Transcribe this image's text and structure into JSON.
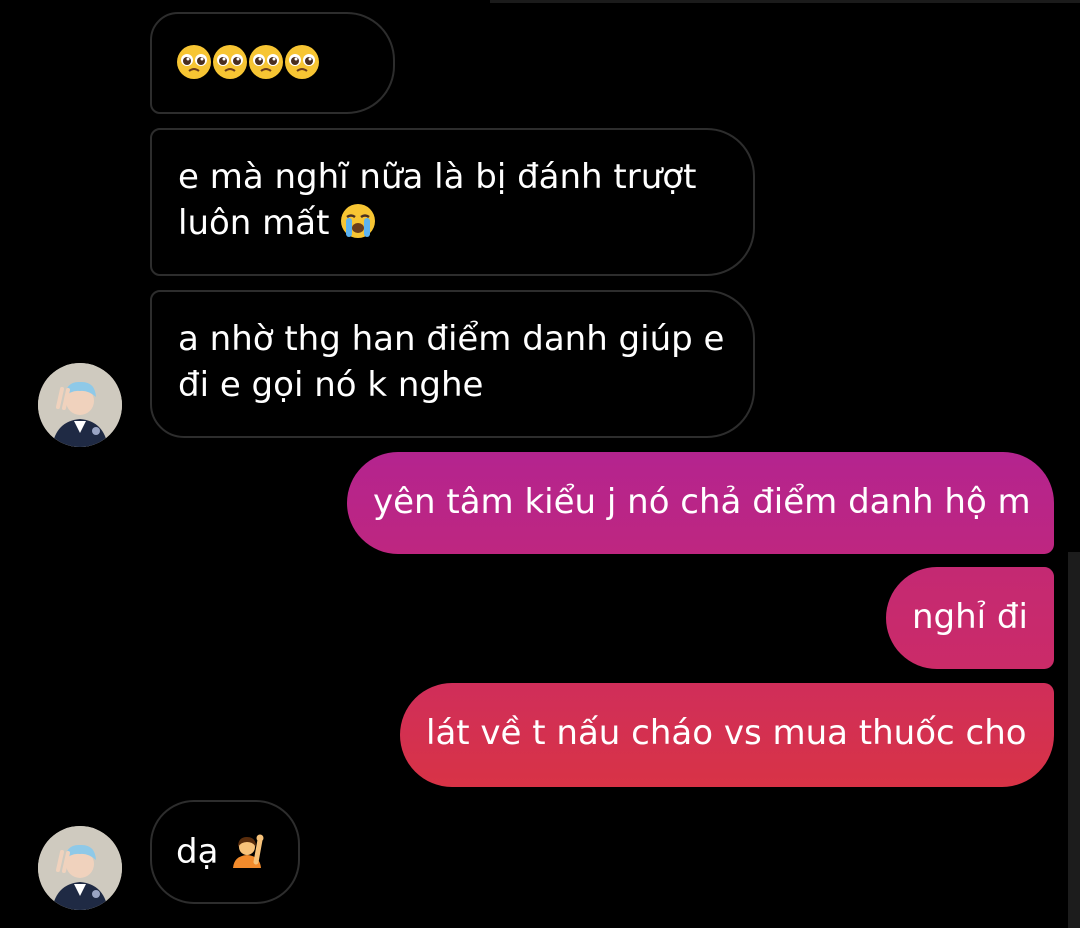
{
  "chat": {
    "messages": [
      {
        "id": "m1",
        "direction": "incoming",
        "text": "",
        "emojis": [
          "pleading-face-icon",
          "pleading-face-icon",
          "pleading-face-icon",
          "pleading-face-icon"
        ]
      },
      {
        "id": "m2",
        "direction": "incoming",
        "text_line1": "e mà nghĩ nữa là bị đánh trượt",
        "text_line2": "luôn mất",
        "emojis": [
          "loudly-crying-face-icon"
        ]
      },
      {
        "id": "m3",
        "direction": "incoming",
        "text_line1": "a nhờ thg han điểm danh giúp e",
        "text_line2": "đi e gọi nó k nghe",
        "emojis": []
      },
      {
        "id": "m4",
        "direction": "outgoing",
        "text": "yên tâm kiểu j nó chả điểm danh hộ m"
      },
      {
        "id": "m5",
        "direction": "outgoing",
        "text": "nghỉ đi"
      },
      {
        "id": "m6",
        "direction": "outgoing",
        "text": "lát về t nấu cháo vs mua thuốc cho"
      },
      {
        "id": "m7",
        "direction": "incoming",
        "text": "dạ",
        "emojis": [
          "person-raising-hand-icon"
        ]
      }
    ]
  },
  "colors": {
    "background": "#000000",
    "incoming_border": "#2d2d2d",
    "outgoing_gradient_top": "#b4248f",
    "outgoing_gradient_bottom": "#d83346",
    "text": "#ffffff"
  },
  "avatar": {
    "icon": "contact-avatar"
  }
}
